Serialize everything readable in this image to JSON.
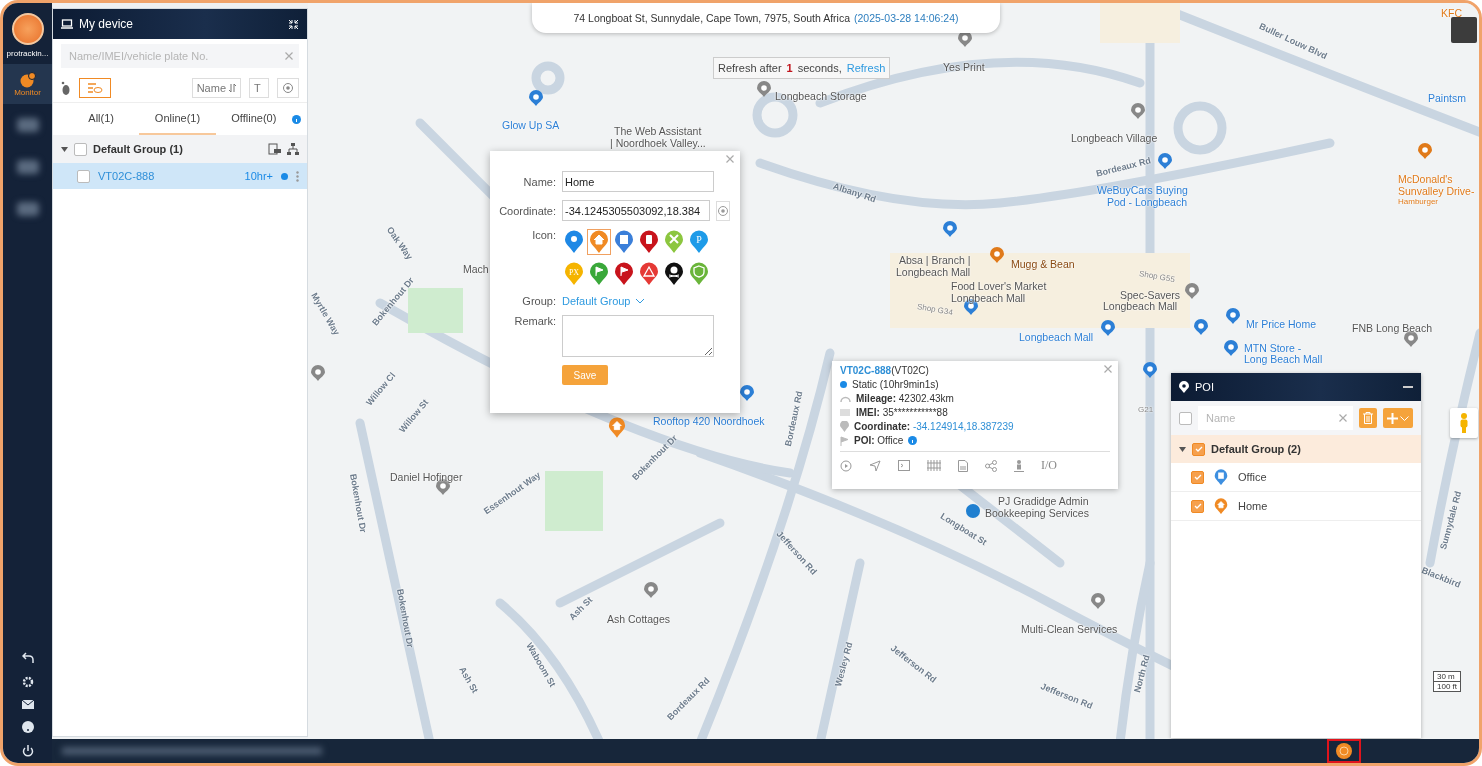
{
  "sidebar": {
    "brand": "protrackin...",
    "items": [
      {
        "label": "Monitor",
        "selected": true
      }
    ]
  },
  "device_panel": {
    "title": "My device",
    "search": {
      "placeholder": "Name/IMEI/vehicle plate No."
    },
    "sort_label": "Name",
    "text_toggle": "T",
    "view_toggle_on": true,
    "tabs": [
      {
        "label": "All(1)",
        "selected": false
      },
      {
        "label": "Online(1)",
        "selected": true
      },
      {
        "label": "Offline(0)",
        "selected": false
      }
    ],
    "groups": [
      {
        "name": "Default Group (1)",
        "expanded": true,
        "checked": false,
        "devices": [
          {
            "name": "VT02C-888",
            "status": "10hr+",
            "checked": false,
            "selected": true,
            "color": "#1a8ae6"
          }
        ]
      }
    ]
  },
  "address_bar": {
    "address": "74 Longboat St, Sunnydale, Cape Town, 7975, South Africa",
    "timestamp": "(2025-03-28 14:06:24)"
  },
  "refresh": {
    "prefix": "Refresh after",
    "count": "1",
    "suffix": "seconds,",
    "link": "Refresh"
  },
  "poi_dialog": {
    "fields": [
      {
        "label": "Name:",
        "value": "Home"
      },
      {
        "label": "Coordinate:",
        "value": "-34.1245305503092,18.384"
      }
    ],
    "icon_label": "Icon:",
    "icons": [
      {
        "kind": "pin",
        "color": "#1e88e5",
        "selected": false
      },
      {
        "kind": "home",
        "color": "#f08a24",
        "selected": true
      },
      {
        "kind": "building",
        "color": "#3b7fd9",
        "selected": false
      },
      {
        "kind": "fuel",
        "color": "#c8141c",
        "selected": false
      },
      {
        "kind": "tools",
        "color": "#8cc63f",
        "selected": false
      },
      {
        "kind": "text",
        "text": "P",
        "color": "#1e9be8",
        "selected": false
      },
      {
        "kind": "text",
        "text": "PX",
        "color": "#f5b400",
        "selected": false
      },
      {
        "kind": "flag",
        "color": "#3aa83a",
        "selected": false
      },
      {
        "kind": "flag",
        "color": "#c8141c",
        "selected": false
      },
      {
        "kind": "warning",
        "color": "#e53935",
        "selected": false
      },
      {
        "kind": "skull",
        "color": "#111111",
        "selected": false
      },
      {
        "kind": "shield",
        "color": "#6ab53a",
        "selected": false
      }
    ],
    "group_label": "Group:",
    "group_value": "Default Group",
    "remark_label": "Remark:",
    "save": "Save"
  },
  "info_popup": {
    "device": "VT02C-888",
    "model": "(VT02C)",
    "status": {
      "text": "Static (10hr9min1s)",
      "color": "#1a8ae6"
    },
    "rows": [
      {
        "kind": "mileage",
        "label": "Mileage:",
        "value": "42302.43km"
      },
      {
        "kind": "imei",
        "label": "IMEI:",
        "value": "35***********88"
      },
      {
        "kind": "coordinate",
        "label": "Coordinate:",
        "value": "-34.124914,18.387239"
      },
      {
        "kind": "poi",
        "label": "POI:",
        "value": "Office"
      }
    ],
    "io": "I/O"
  },
  "poi_panel": {
    "title": "POI",
    "search": {
      "placeholder": "Name"
    },
    "all_checked": false,
    "groups": [
      {
        "name": "Default Group (2)",
        "checked": true,
        "expanded": true,
        "items": [
          {
            "name": "Office",
            "checked": true,
            "kind": "building",
            "color": "#3d8fe0"
          },
          {
            "name": "Home",
            "checked": true,
            "kind": "home",
            "color": "#f08a24"
          }
        ]
      }
    ]
  },
  "map": {
    "labels": [
      {
        "text": "Yes Print",
        "kind": "place"
      },
      {
        "text": "Longbeach Storage",
        "kind": "place"
      },
      {
        "text": "Glow Up SA",
        "kind": "store"
      },
      {
        "text": "The Web Assistant",
        "kind": "place"
      },
      {
        "text": "| Noordhoek Valley...",
        "kind": "place"
      },
      {
        "text": "Longbeach Village",
        "kind": "place"
      },
      {
        "text": "WeBuyCars Buying",
        "kind": "store"
      },
      {
        "text": "Pod - Longbeach",
        "kind": "store"
      },
      {
        "text": "McDonald's",
        "kind": "food"
      },
      {
        "text": "Sunvalley Drive-",
        "kind": "food"
      },
      {
        "text": "Hamburger",
        "kind": "note"
      },
      {
        "text": "Absa | Branch |",
        "kind": "place"
      },
      {
        "text": "Longbeach Mall",
        "kind": "place"
      },
      {
        "text": "Mugg & Bean",
        "kind": "cafe"
      },
      {
        "text": "Food Lover's Market",
        "kind": "place"
      },
      {
        "text": "Longbeach Mall",
        "kind": "place"
      },
      {
        "text": "Spec-Savers",
        "kind": "place"
      },
      {
        "text": "Longbeach Mall",
        "kind": "place"
      },
      {
        "text": "Shop G55",
        "kind": "shop"
      },
      {
        "text": "Shop G34",
        "kind": "shop"
      },
      {
        "text": "Longbeach Mall",
        "kind": "store"
      },
      {
        "text": "Mr Price Home",
        "kind": "store"
      },
      {
        "text": "FNB Long Beach",
        "kind": "place"
      },
      {
        "text": "MTN Store -",
        "kind": "store"
      },
      {
        "text": "Long Beach Mall",
        "kind": "store"
      },
      {
        "text": "Rooftop 420 Noordhoek",
        "kind": "store"
      },
      {
        "text": "Mach",
        "kind": "place"
      },
      {
        "text": "Daniel Hofinger",
        "kind": "place"
      },
      {
        "text": "PJ Gradidge Admin",
        "kind": "place"
      },
      {
        "text": "Bookkeeping Services",
        "kind": "place"
      },
      {
        "text": "Ash Cottages",
        "kind": "place"
      },
      {
        "text": "Multi-Clean Services",
        "kind": "place"
      },
      {
        "text": "KFC",
        "kind": "food"
      },
      {
        "text": "Paintsm",
        "kind": "store"
      },
      {
        "text": "Buller Louw Blvd",
        "kind": "street"
      },
      {
        "text": "Albany Rd",
        "kind": "street"
      },
      {
        "text": "Bordeaux Rd",
        "kind": "street"
      },
      {
        "text": "Oak Way",
        "kind": "street"
      },
      {
        "text": "Bokenhout Dr",
        "kind": "street"
      },
      {
        "text": "Myrtle Way",
        "kind": "street"
      },
      {
        "text": "Willow Cl",
        "kind": "street"
      },
      {
        "text": "Willow St",
        "kind": "street"
      },
      {
        "text": "Essenhout Way",
        "kind": "street"
      },
      {
        "text": "Bokenhout Dr",
        "kind": "street"
      },
      {
        "text": "Bokenhout Dr",
        "kind": "street"
      },
      {
        "text": "Bokenhout Dr",
        "kind": "street"
      },
      {
        "text": "Bordeaux Rd",
        "kind": "street"
      },
      {
        "text": "Longboat St",
        "kind": "street"
      },
      {
        "text": "Jefferson Rd",
        "kind": "street"
      },
      {
        "text": "Ash St",
        "kind": "street"
      },
      {
        "text": "Waboom St",
        "kind": "street"
      },
      {
        "text": "Ash St",
        "kind": "street"
      },
      {
        "text": "Bordeaux Rd",
        "kind": "street"
      },
      {
        "text": "Wesley Rd",
        "kind": "street"
      },
      {
        "text": "Jefferson Rd",
        "kind": "street"
      },
      {
        "text": "Jefferson Rd",
        "kind": "street"
      },
      {
        "text": "North Rd",
        "kind": "street"
      },
      {
        "text": "Sunnydale Rd",
        "kind": "street"
      },
      {
        "text": "Blackbird",
        "kind": "street"
      },
      {
        "text": "G21",
        "kind": "shop"
      }
    ],
    "scale": [
      "30 m",
      "100 ft"
    ]
  }
}
